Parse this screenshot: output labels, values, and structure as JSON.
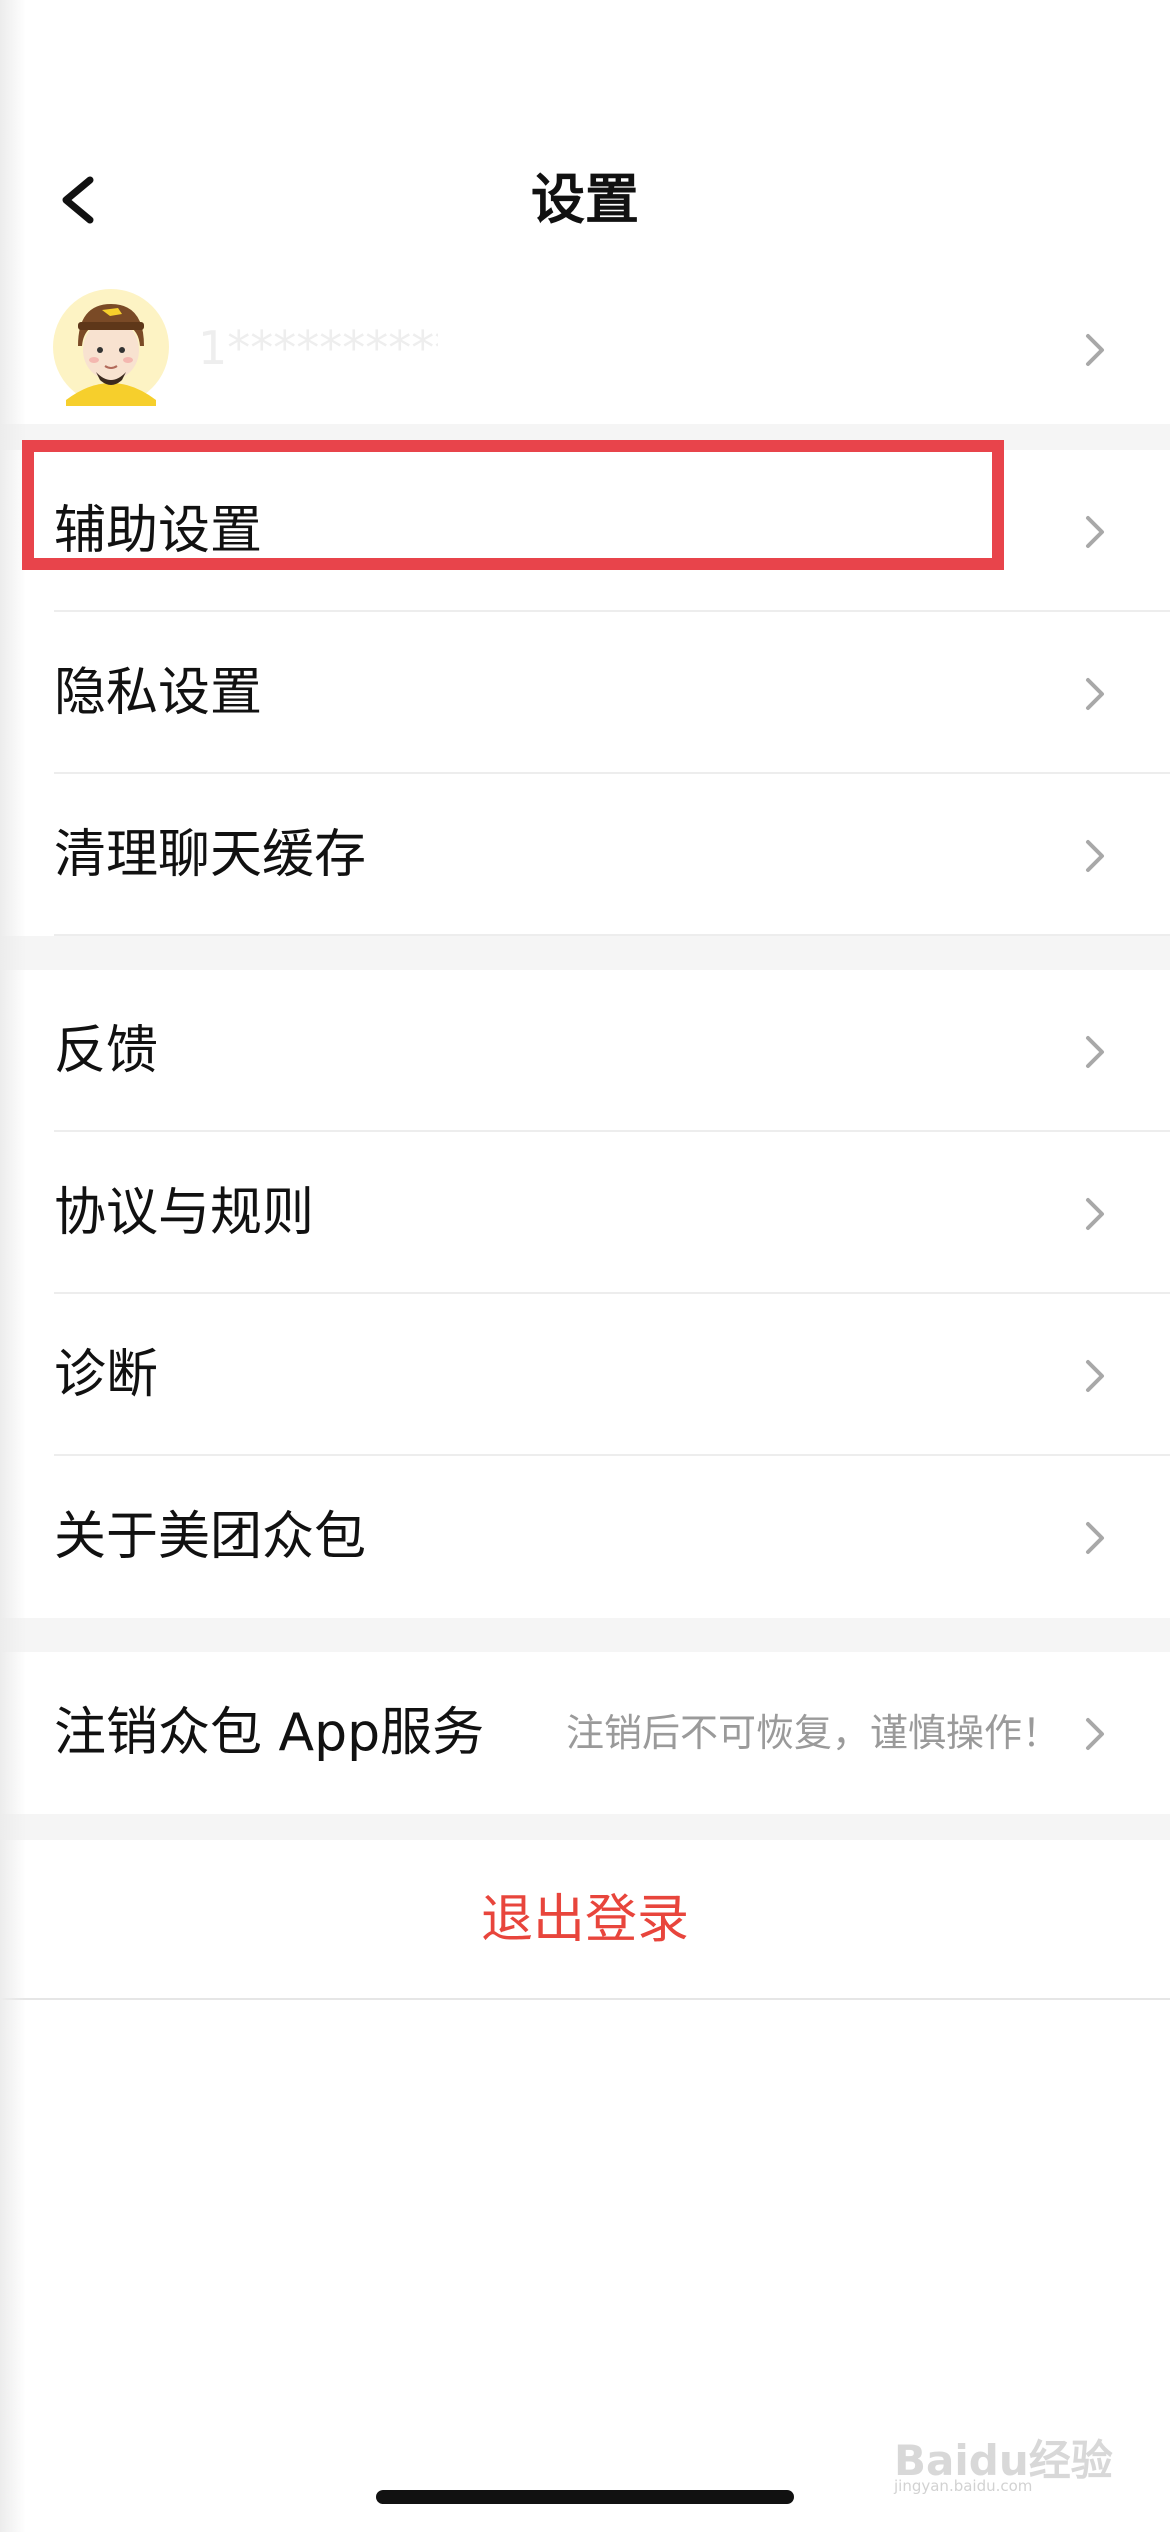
{
  "header": {
    "title": "设置"
  },
  "profile": {
    "masked_phone": "1**********"
  },
  "groups": [
    {
      "items": [
        {
          "label": "辅助设置"
        },
        {
          "label": "隐私设置"
        },
        {
          "label": "清理聊天缓存"
        }
      ]
    },
    {
      "items": [
        {
          "label": "反馈"
        },
        {
          "label": "协议与规则"
        },
        {
          "label": "诊断"
        },
        {
          "label": "关于美团众包"
        }
      ]
    },
    {
      "items": [
        {
          "label": "注销众包 App服务",
          "note": "注销后不可恢复，谨慎操作！"
        }
      ]
    }
  ],
  "logout": {
    "label": "退出登录"
  },
  "watermark": {
    "brand": "Baidu经验",
    "domain": "jingyan.baidu.com"
  },
  "colors": {
    "logout_text": "#e8453c",
    "highlight_border": "#e8444b",
    "chevron": "#a8a8a8"
  },
  "icons": {
    "back": "chevron-left-icon",
    "row": "chevron-right-icon",
    "avatar": "rider-avatar"
  }
}
